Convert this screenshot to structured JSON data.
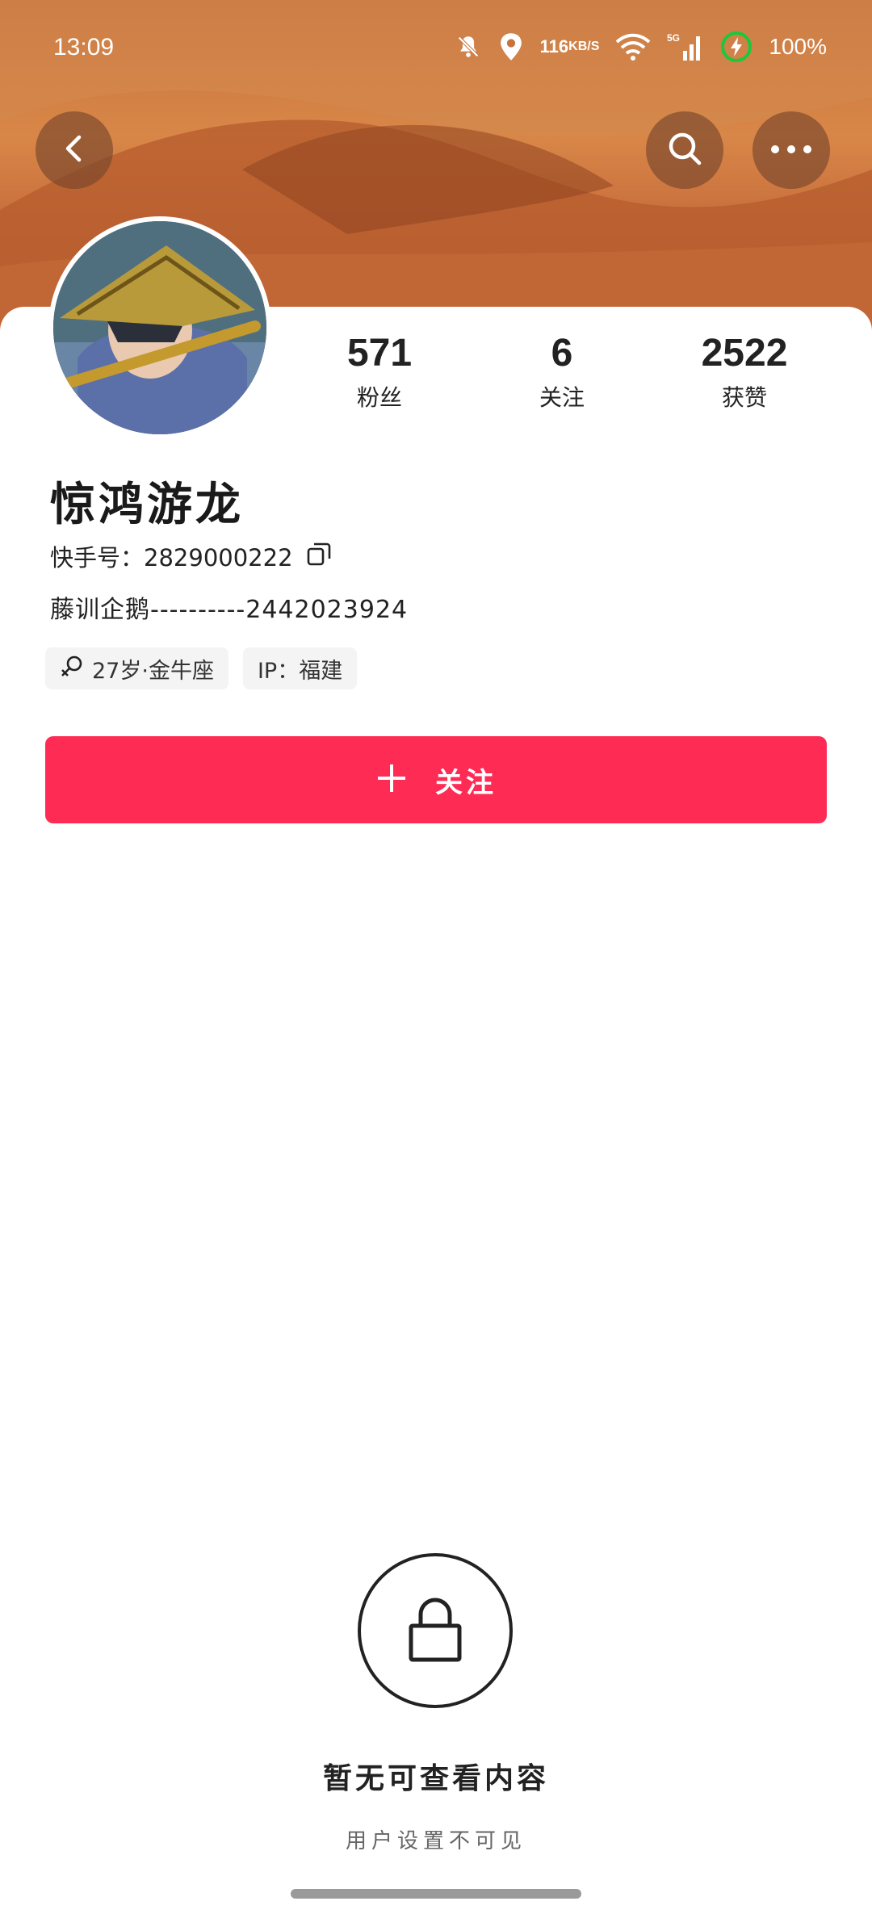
{
  "status_bar": {
    "time": "13:09",
    "net_speed_value": "116",
    "net_speed_unit": "KB/S",
    "network_type": "5G",
    "battery": "100%",
    "icons": [
      "mute-bell-icon",
      "location-icon",
      "wifi-icon",
      "signal-icon",
      "battery-charging-icon"
    ]
  },
  "nav": {
    "back_icon": "back-arrow-icon",
    "search_icon": "search-icon",
    "more_icon": "more-dots-icon"
  },
  "stats": {
    "fans_value": "571",
    "fans_label": "粉丝",
    "follow_value": "6",
    "follow_label": "关注",
    "likes_value": "2522",
    "likes_label": "获赞"
  },
  "profile": {
    "nickname": "惊鸿游龙",
    "kwai_id_label": "快手号：",
    "kwai_id": "2829000222",
    "bio": "藤训企鹅----------2442023924",
    "age_tag": "27岁·金牛座",
    "ip_tag": "IP：福建"
  },
  "follow_button": {
    "label": "关注"
  },
  "empty_state": {
    "title": "暂无可查看内容",
    "subtitle": "用户设置不可见"
  },
  "colors": {
    "accent": "#fe2c55",
    "banner": "#d98748"
  }
}
